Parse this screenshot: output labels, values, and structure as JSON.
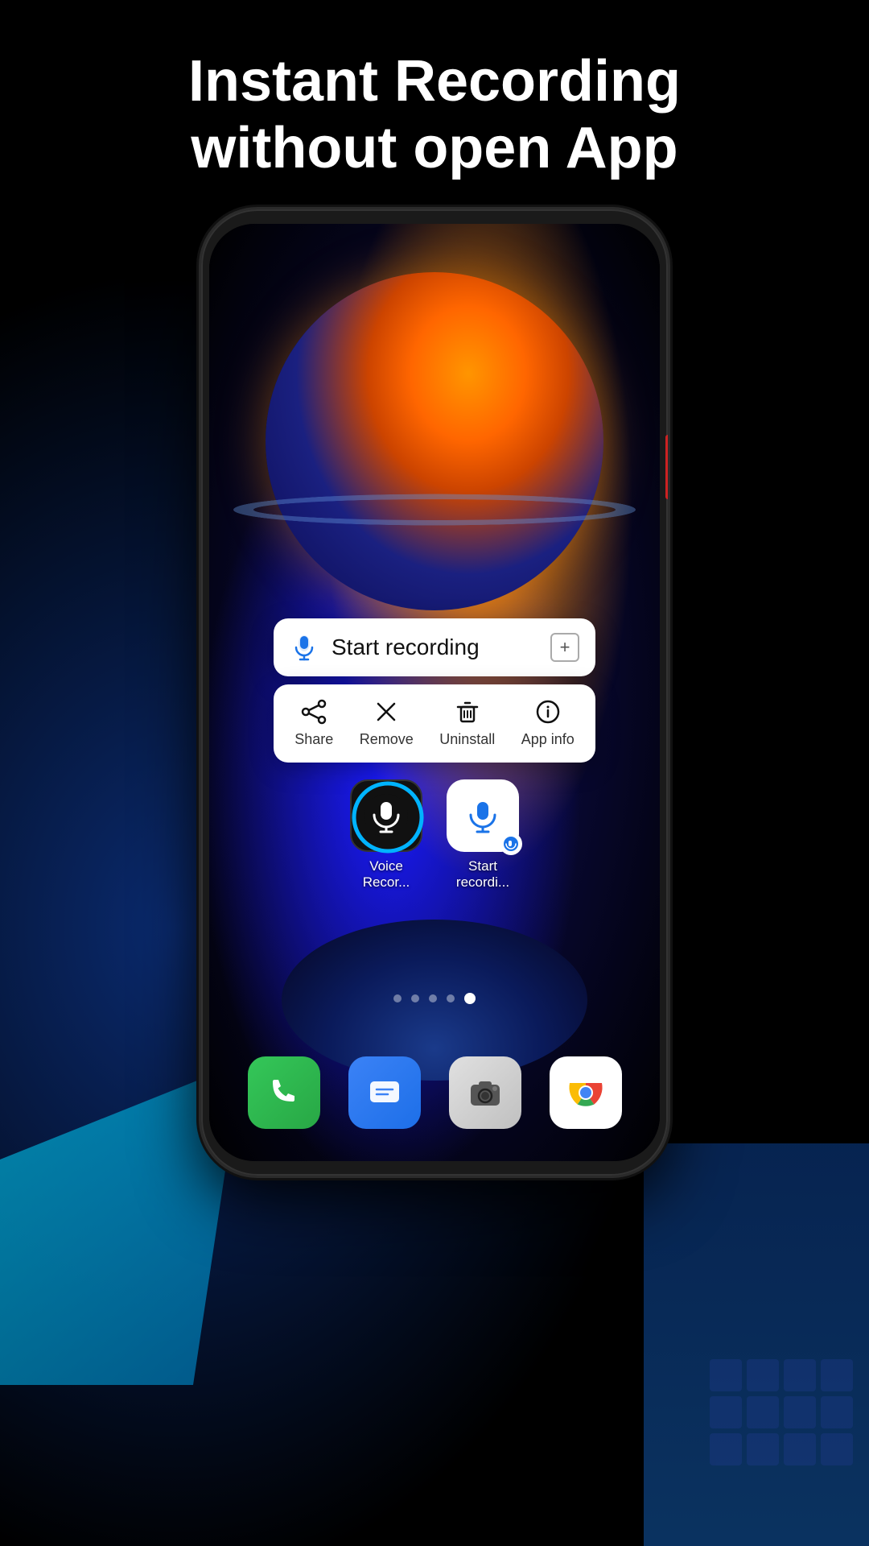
{
  "header": {
    "line1": "Instant Recording",
    "line2": "without open App"
  },
  "context_menu": {
    "shortcut_label": "Start recording",
    "plus_icon": "+",
    "actions": [
      {
        "icon": "share",
        "label": "Share"
      },
      {
        "icon": "remove",
        "label": "Remove"
      },
      {
        "icon": "uninstall",
        "label": "Uninstall"
      },
      {
        "icon": "info",
        "label": "App info"
      }
    ]
  },
  "app_icons": [
    {
      "name": "Voice Recor...",
      "type": "main"
    },
    {
      "name": "Start recordi...",
      "type": "shortcut"
    }
  ],
  "page_dots": [
    {
      "active": false
    },
    {
      "active": false
    },
    {
      "active": false
    },
    {
      "active": false
    },
    {
      "active": true
    }
  ],
  "dock": [
    {
      "name": "Phone",
      "type": "phone"
    },
    {
      "name": "Messages",
      "type": "messages"
    },
    {
      "name": "Camera",
      "type": "camera"
    },
    {
      "name": "Chrome",
      "type": "chrome"
    }
  ]
}
